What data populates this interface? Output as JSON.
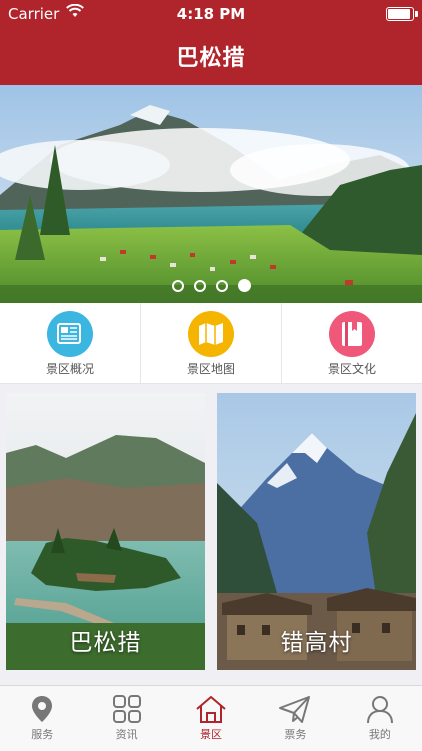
{
  "status_bar": {
    "carrier": "Carrier",
    "time": "4:18 PM",
    "battery_level": 1.0
  },
  "header": {
    "title": "巴松措"
  },
  "banner": {
    "slide_count": 4,
    "active_slide": 4
  },
  "quick_links": [
    {
      "label": "景区概况",
      "icon": "newspaper-icon",
      "color": "#3bb6e0"
    },
    {
      "label": "景区地图",
      "icon": "map-icon",
      "color": "#f4b400"
    },
    {
      "label": "景区文化",
      "icon": "book-icon",
      "color": "#f0587a"
    }
  ],
  "cards": [
    {
      "label": "巴松措"
    },
    {
      "label": "错高村"
    }
  ],
  "tabs": [
    {
      "label": "服务",
      "icon": "location-pin-icon"
    },
    {
      "label": "资讯",
      "icon": "grid-icon"
    },
    {
      "label": "景区",
      "icon": "home-icon",
      "active": true
    },
    {
      "label": "票务",
      "icon": "paper-plane-icon"
    },
    {
      "label": "我的",
      "icon": "user-icon"
    }
  ],
  "colors": {
    "brand": "#b0252c"
  }
}
